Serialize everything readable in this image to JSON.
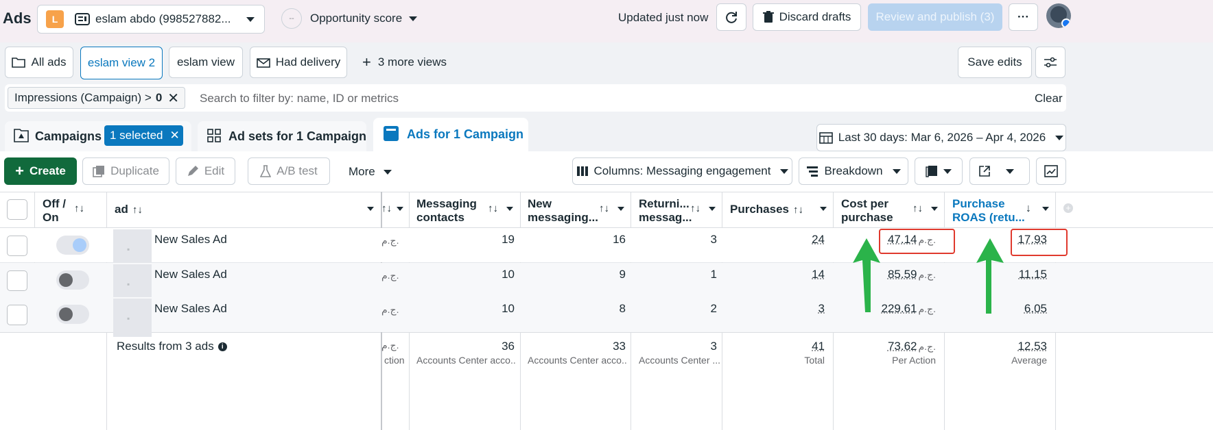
{
  "top": {
    "app_title": "Ads",
    "account_initial": "L",
    "account_name": "eslam abdo (998527882...",
    "opportunity_label": "Opportunity score",
    "opportunity_value": "--",
    "updated": "Updated just now",
    "discard": "Discard drafts",
    "review": "Review and publish (3)",
    "more": "···"
  },
  "views": {
    "all_ads": "All ads",
    "view2": "eslam view 2",
    "view1": "eslam view",
    "had_delivery": "Had delivery",
    "more_views": "3 more views",
    "save_edits": "Save edits"
  },
  "filter": {
    "chip_label": "Impressions (Campaign) >",
    "chip_value": "0",
    "search_placeholder": "Search to filter by: name, ID or metrics",
    "clear": "Clear"
  },
  "tabs": {
    "campaigns": "Campaigns",
    "selected_badge": "1 selected",
    "adsets": "Ad sets for 1 Campaign",
    "ads": "Ads for 1 Campaign",
    "date_range": "Last 30 days: Mar 6, 2026 – Apr 4, 2026"
  },
  "toolbar": {
    "create": "Create",
    "duplicate": "Duplicate",
    "edit": "Edit",
    "abtest": "A/B test",
    "more": "More",
    "columns": "Columns: Messaging engagement",
    "breakdown": "Breakdown"
  },
  "table": {
    "headers": {
      "offon": "Off / On",
      "ad": "ad",
      "messaging_contacts": "Messaging contacts",
      "new_messaging": "New messaging...",
      "returning": "Returni... messag...",
      "purchases": "Purchases",
      "cost_per_purchase": "Cost per purchase",
      "roas": "Purchase ROAS (retu..."
    },
    "currency": "ج.م.",
    "rows": [
      {
        "name": "New Sales Ad",
        "contacts": "19",
        "new_msg": "16",
        "returning": "3",
        "purchases": "24",
        "cost": "47.14",
        "roas": "17.93",
        "on": true
      },
      {
        "name": "New Sales Ad",
        "contacts": "10",
        "new_msg": "9",
        "returning": "1",
        "purchases": "14",
        "cost": "85.59",
        "roas": "11.15",
        "on": false
      },
      {
        "name": "New Sales Ad",
        "contacts": "10",
        "new_msg": "8",
        "returning": "2",
        "purchases": "3",
        "cost": "229.61",
        "roas": "6.05",
        "on": false
      }
    ],
    "summary": {
      "label": "Results from 3 ads",
      "prev_sub": "ction",
      "contacts": "36",
      "contacts_sub": "Accounts Center acco...",
      "new_msg": "33",
      "new_msg_sub": "Accounts Center acco...",
      "returning": "3",
      "returning_sub": "Accounts Center ...",
      "purchases": "41",
      "purchases_sub": "Total",
      "cost": "73.62",
      "cost_sub": "Per Action",
      "roas": "12.53",
      "roas_sub": "Average"
    }
  },
  "colors": {
    "accent": "#0a78be",
    "create_green": "#116a3c",
    "highlight_red": "#e0392d",
    "arrow_green": "#2bb34a",
    "review_disabled": "#b8d3ef"
  }
}
